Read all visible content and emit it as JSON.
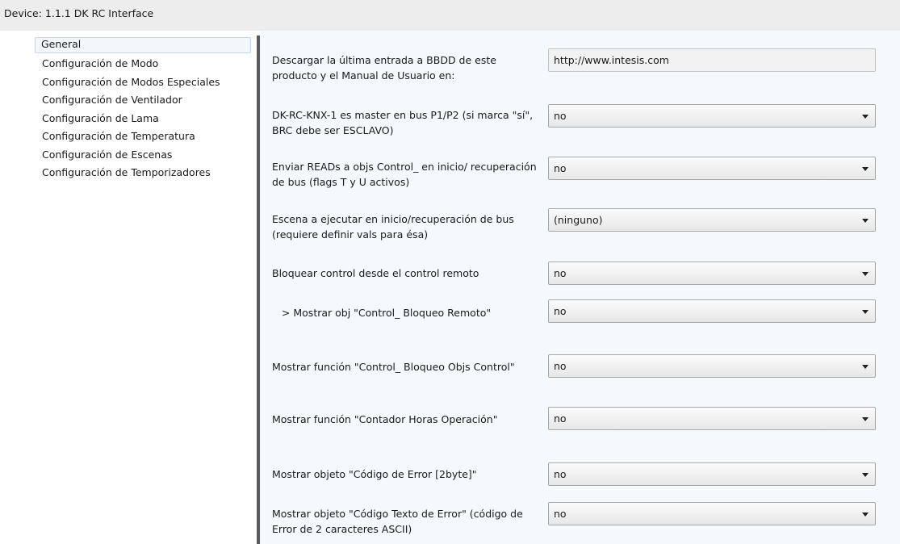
{
  "title": "Device: 1.1.1  DK RC Interface",
  "sidebar": {
    "items": [
      {
        "label": "General",
        "selected": true
      },
      {
        "label": "Configuración de Modo"
      },
      {
        "label": "Configuración de Modos Especiales"
      },
      {
        "label": "Configuración de Ventilador"
      },
      {
        "label": "Configuración de Lama"
      },
      {
        "label": "Configuración de Temperatura"
      },
      {
        "label": "Configuración de Escenas"
      },
      {
        "label": "Configuración de Temporizadores"
      }
    ]
  },
  "params": [
    {
      "label": "Descargar la última entrada a BBDD de este producto y el Manual de Usuario en:",
      "value": "http://www.intesis.com",
      "kind": "text"
    },
    {
      "label": "DK-RC-KNX-1 es master en bus P1/P2 (si marca \"sí\", BRC debe ser ESCLAVO)",
      "value": "no",
      "kind": "select"
    },
    {
      "label": "Enviar READs a objs Control_ en inicio/ recuperación de bus (flags T y U activos)",
      "value": "no",
      "kind": "select"
    },
    {
      "label": "Escena a ejecutar en inicio/recuperación de bus (requiere definir vals para ésa)",
      "value": "(ninguno)",
      "kind": "select"
    },
    {
      "label": "Bloquear control desde el control remoto",
      "value": "no",
      "kind": "select"
    },
    {
      "label": "   > Mostrar obj \"Control_ Bloqueo Remoto\"",
      "value": "no",
      "kind": "select"
    },
    {
      "label": "Mostrar función \"Control_ Bloqueo Objs Control\"",
      "value": "no",
      "kind": "select"
    },
    {
      "label": "Mostrar función \"Contador Horas Operación\"",
      "value": "no",
      "kind": "select"
    },
    {
      "label": "Mostrar objeto \"Código de Error [2byte]\"",
      "value": "no",
      "kind": "select"
    },
    {
      "label": "Mostrar objeto \"Código Texto de Error\" (código de Error de 2 caracteres ASCII)",
      "value": "no",
      "kind": "select"
    }
  ]
}
